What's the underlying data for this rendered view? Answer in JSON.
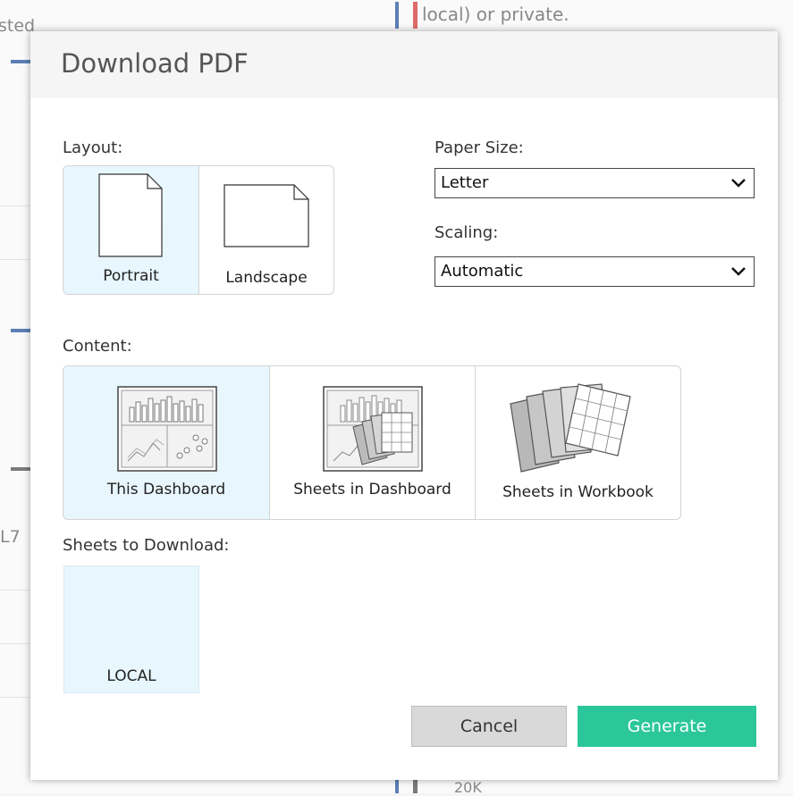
{
  "background": {
    "fragments": [
      "sted",
      "local) or private.",
      "L7",
      "20K"
    ],
    "accent_red": "#e06a6a",
    "accent_blue": "#5b7fb5"
  },
  "dialog": {
    "title": "Download PDF",
    "layout": {
      "label": "Layout:",
      "options": [
        {
          "label": "Portrait",
          "icon": "portrait-page-icon",
          "selected": true
        },
        {
          "label": "Landscape",
          "icon": "landscape-page-icon",
          "selected": false
        }
      ]
    },
    "paper_size": {
      "label": "Paper Size:",
      "value": "Letter"
    },
    "scaling": {
      "label": "Scaling:",
      "value": "Automatic"
    },
    "content": {
      "label": "Content:",
      "options": [
        {
          "label": "This Dashboard",
          "icon": "dashboard-icon",
          "selected": true
        },
        {
          "label": "Sheets in Dashboard",
          "icon": "sheets-in-dashboard-icon",
          "selected": false
        },
        {
          "label": "Sheets in Workbook",
          "icon": "sheets-in-workbook-icon",
          "selected": false
        }
      ]
    },
    "sheets_to_download": {
      "label": "Sheets to Download:",
      "items": [
        {
          "label": "LOCAL",
          "selected": true
        }
      ]
    },
    "buttons": {
      "cancel": "Cancel",
      "generate": "Generate"
    },
    "colors": {
      "selected_bg": "#e8f6fe",
      "generate_bg": "#2bc79a",
      "cancel_bg": "#d9d9d9",
      "header_bg": "#f5f5f5"
    }
  }
}
